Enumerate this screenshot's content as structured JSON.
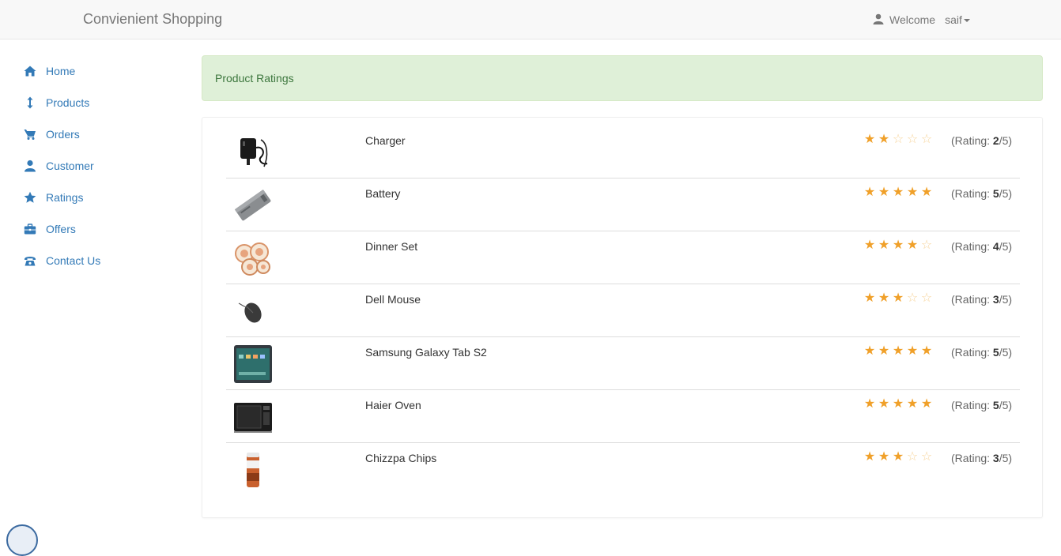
{
  "brand": "Convienient Shopping",
  "user": {
    "welcome": "Welcome",
    "name": "saif"
  },
  "sidebar": {
    "items": [
      {
        "label": "Home",
        "icon": "home-icon"
      },
      {
        "label": "Products",
        "icon": "vertical-arrows-icon"
      },
      {
        "label": "Orders",
        "icon": "shopping-cart-icon"
      },
      {
        "label": "Customer",
        "icon": "user-icon"
      },
      {
        "label": "Ratings",
        "icon": "star-icon"
      },
      {
        "label": "Offers",
        "icon": "briefcase-icon"
      },
      {
        "label": "Contact Us",
        "icon": "phone-icon"
      }
    ]
  },
  "alert": {
    "text": "Product Ratings"
  },
  "rating_label": "Rating:",
  "rating_max": "/5",
  "products": [
    {
      "name": "Charger",
      "rating": "2",
      "image": "charger-image"
    },
    {
      "name": "Battery",
      "rating": "5",
      "image": "battery-image"
    },
    {
      "name": "Dinner Set",
      "rating": "4",
      "image": "dinner-set-image"
    },
    {
      "name": "Dell Mouse",
      "rating": "3",
      "image": "mouse-image"
    },
    {
      "name": "Samsung Galaxy Tab S2",
      "rating": "5",
      "image": "tablet-image"
    },
    {
      "name": "Haier Oven",
      "rating": "5",
      "image": "oven-image"
    },
    {
      "name": "Chizzpa Chips",
      "rating": "3",
      "image": "chips-image"
    }
  ],
  "colors": {
    "link": "#337ab7",
    "star": "#f0a029",
    "star_empty": "#f7d49a",
    "alert_bg": "#dff0d8",
    "alert_text": "#3c763d"
  }
}
